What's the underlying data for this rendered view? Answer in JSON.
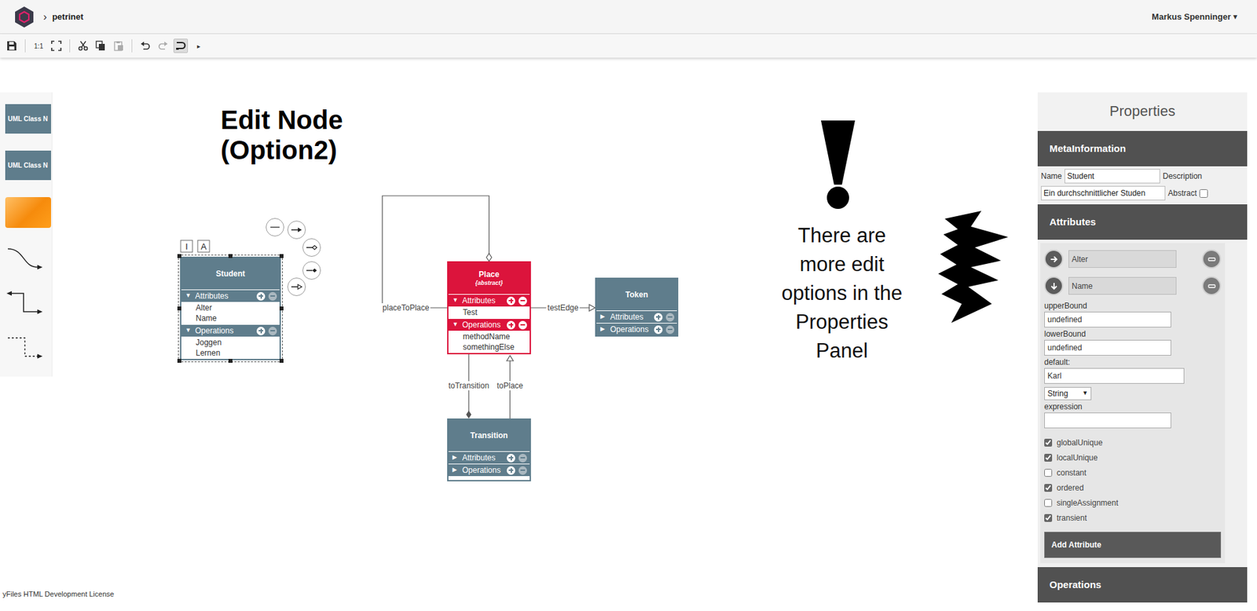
{
  "header": {
    "breadcrumb_separator": "›",
    "project": "petrinet",
    "user": "Markus Spenninger",
    "user_caret": "▾"
  },
  "toolbar": {
    "zoom_label": "1:1",
    "more": "▸",
    "paste_disabled": true,
    "redo_disabled": true,
    "snapping_on": true
  },
  "palette": {
    "node_templates": [
      "UML Class N",
      "UML Class N"
    ]
  },
  "canvas": {
    "heading": [
      "Edit Node",
      "(Option2)"
    ],
    "note": [
      "There are",
      "more edit",
      "options in the",
      "Properties",
      "Panel"
    ],
    "selection_tags": [
      "I",
      "A"
    ],
    "nodes": [
      {
        "name": "Student",
        "selected": true,
        "color": "#5f7d8c",
        "sections": [
          {
            "title": "Attributes",
            "toggle": "▼",
            "expanded": true,
            "items": [
              "Alter",
              "Name"
            ]
          },
          {
            "title": "Operations",
            "toggle": "▼",
            "expanded": true,
            "items": [
              "Joggen",
              "Lernen"
            ]
          }
        ]
      },
      {
        "name": "Place",
        "stereotype": "{abstract}",
        "selected": false,
        "color": "#dc143c",
        "sections": [
          {
            "title": "Attributes",
            "toggle": "▼",
            "expanded": true,
            "items": [
              "Test"
            ]
          },
          {
            "title": "Operations",
            "toggle": "▼",
            "expanded": true,
            "items": [
              "methodName",
              "somethingElse"
            ]
          }
        ]
      },
      {
        "name": "Token",
        "selected": false,
        "color": "#5f7d8c",
        "sections": [
          {
            "title": "Attributes",
            "toggle": "▶",
            "expanded": false,
            "items": []
          },
          {
            "title": "Operations",
            "toggle": "▶",
            "expanded": false,
            "items": []
          }
        ]
      },
      {
        "name": "Transition",
        "selected": false,
        "color": "#5f7d8c",
        "sections": [
          {
            "title": "Attributes",
            "toggle": "▶",
            "expanded": false,
            "items": []
          },
          {
            "title": "Operations",
            "toggle": "▶",
            "expanded": false,
            "items": []
          }
        ]
      }
    ],
    "edges": [
      {
        "label": "placeToPlace"
      },
      {
        "label": "testEdge"
      },
      {
        "label": "toTransition"
      },
      {
        "label": "toPlace"
      }
    ]
  },
  "properties": {
    "title": "Properties",
    "meta": {
      "title": "MetaInformation",
      "name_label": "Name",
      "name": "Student",
      "description_label": "Description",
      "description": "Ein durchschnittlicher Studen",
      "abstract_label": "Abstract",
      "abstract": false
    },
    "attributes": {
      "title": "Attributes",
      "items": [
        {
          "name": "Alter",
          "expanded": false
        },
        {
          "name": "Name",
          "expanded": true
        }
      ],
      "detail": {
        "upper_bound_label": "upperBound",
        "upper_bound": "undefined",
        "lower_bound_label": "lowerBound",
        "lower_bound": "undefined",
        "default_label": "default:",
        "default": "Karl",
        "type": "String",
        "type_caret": "▼",
        "expression_label": "expression",
        "expression": "",
        "flags": [
          {
            "label": "globalUnique",
            "checked": true
          },
          {
            "label": "localUnique",
            "checked": true
          },
          {
            "label": "constant",
            "checked": false
          },
          {
            "label": "ordered",
            "checked": true
          },
          {
            "label": "singleAssignment",
            "checked": false
          },
          {
            "label": "transient",
            "checked": true
          }
        ]
      },
      "add_button": "Add Attribute"
    },
    "operations": {
      "title": "Operations"
    }
  },
  "footer": {
    "license": "yFiles HTML Development License"
  }
}
